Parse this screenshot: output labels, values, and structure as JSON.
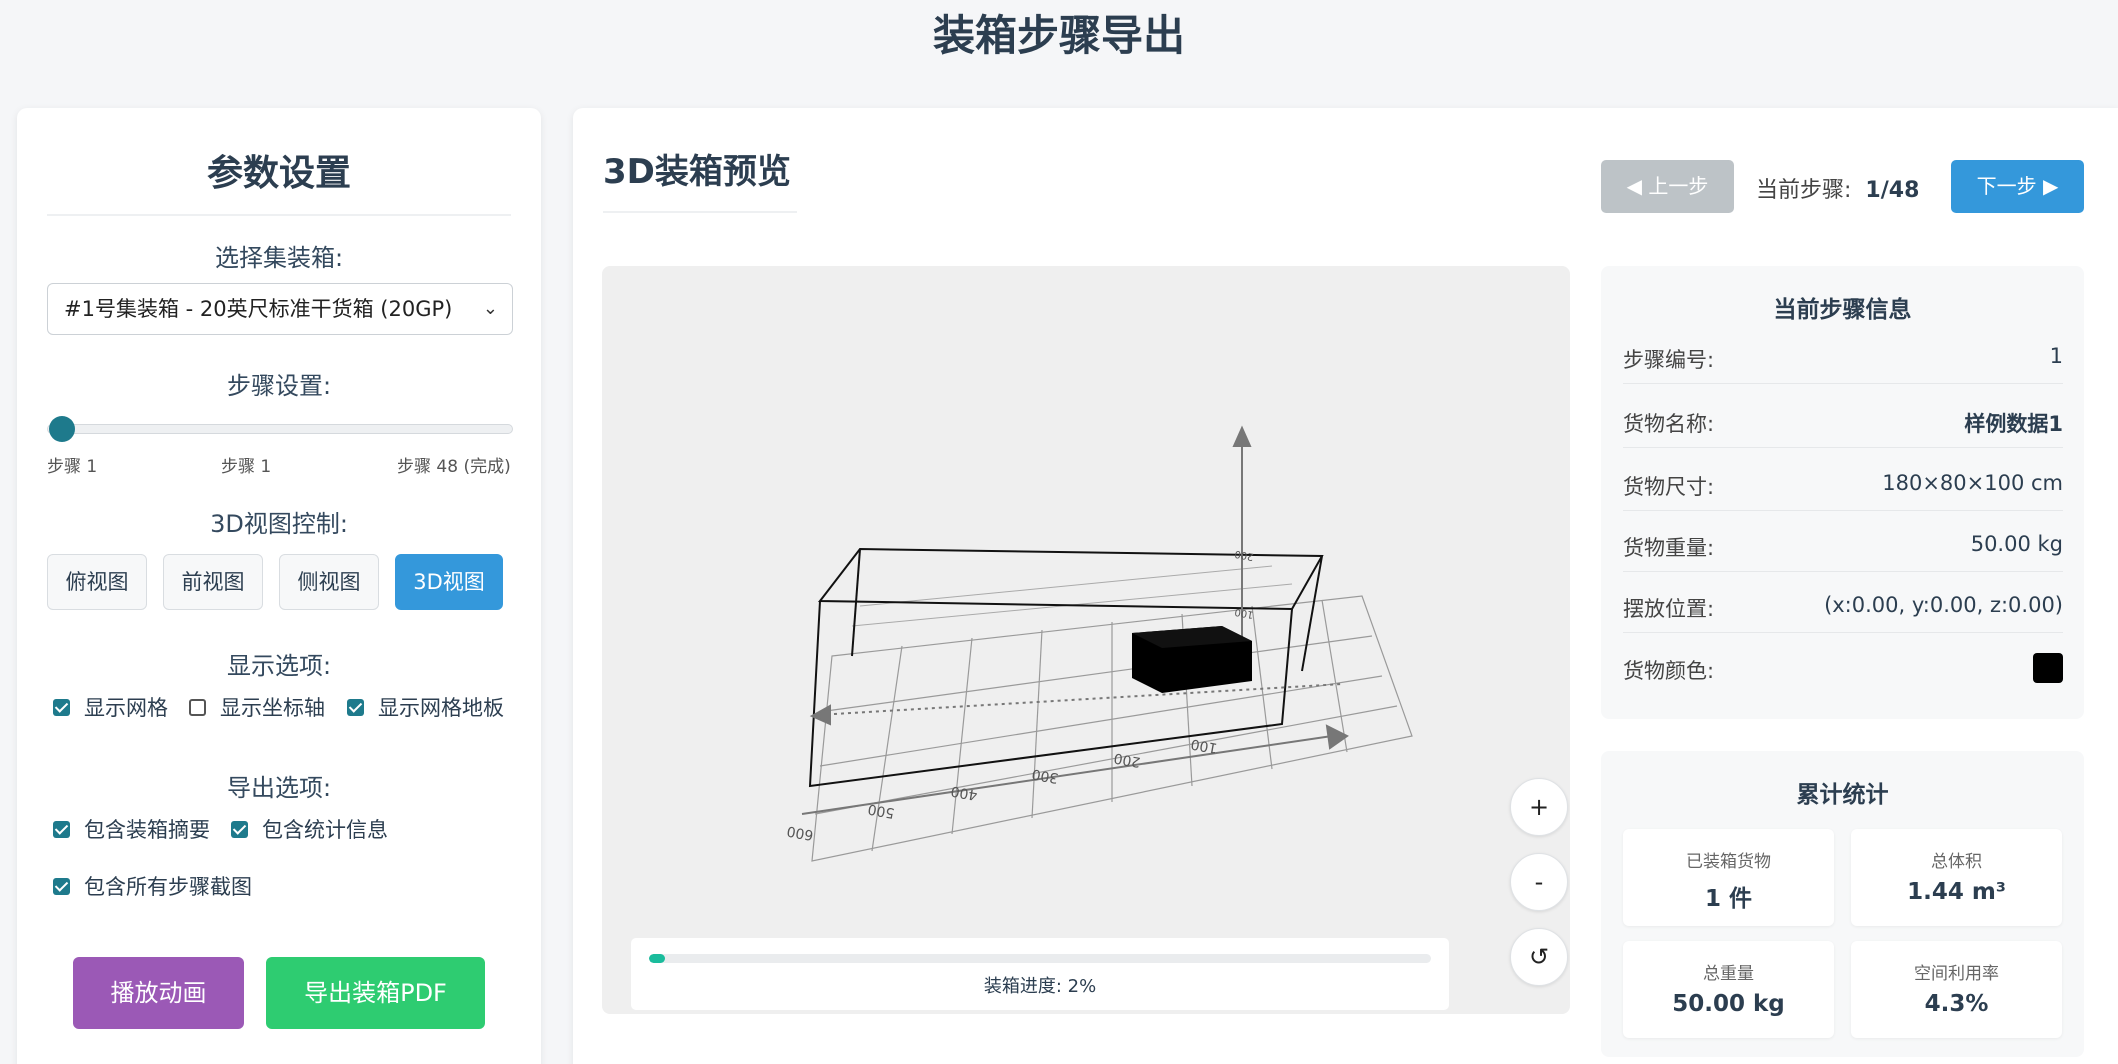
{
  "page": {
    "title": "装箱步骤导出"
  },
  "settings": {
    "title": "参数设置",
    "container_label": "选择集装箱:",
    "container_selected": "#1号集装箱 - 20英尺标准干货箱 (20GP)",
    "step_label": "步骤设置:",
    "step_min": "步骤 1",
    "step_current": "步骤 1",
    "step_max": "步骤 48 (完成)",
    "step_slider_fraction": 0.0,
    "view_label": "3D视图控制:",
    "views": [
      {
        "label": "俯视图",
        "active": false
      },
      {
        "label": "前视图",
        "active": false
      },
      {
        "label": "侧视图",
        "active": false
      },
      {
        "label": "3D视图",
        "active": true
      }
    ],
    "display_label": "显示选项:",
    "display_options": [
      {
        "label": "显示网格",
        "checked": true
      },
      {
        "label": "显示坐标轴",
        "checked": false
      },
      {
        "label": "显示网格地板",
        "checked": true
      }
    ],
    "export_label": "导出选项:",
    "export_options": [
      {
        "label": "包含装箱摘要",
        "checked": true
      },
      {
        "label": "包含统计信息",
        "checked": true
      },
      {
        "label": "包含所有步骤截图",
        "checked": true
      }
    ],
    "play_button": "播放动画",
    "export_button": "导出装箱PDF",
    "colors": {
      "accent": "#1e7a8c",
      "play": "#9b59b6",
      "export": "#2ecc71",
      "active_view": "#3498db"
    }
  },
  "preview": {
    "title": "3D装箱预览",
    "prev_button": "◀ 上一步",
    "next_button": "下一步 ▶",
    "step_text": "当前步骤:",
    "step_value": "1/48",
    "progress_label": "装箱进度: 2%",
    "progress_fraction": 0.02,
    "zoom_in": "+",
    "zoom_out": "-",
    "reset": "↺",
    "scale_labels": [
      "600",
      "500",
      "400",
      "300",
      "200",
      "100"
    ],
    "height_labels": [
      "200",
      "100"
    ],
    "colors": {
      "prev_disabled": "#bdc3c7",
      "next": "#3498db",
      "progress": "#1abc9c"
    }
  },
  "step_info": {
    "title": "当前步骤信息",
    "rows": [
      {
        "key": "步骤编号:",
        "value": "1"
      },
      {
        "key": "货物名称:",
        "value": "样例数据1"
      },
      {
        "key": "货物尺寸:",
        "value": "180×80×100 cm"
      },
      {
        "key": "货物重量:",
        "value": "50.00 kg"
      },
      {
        "key": "摆放位置:",
        "value": "(x:0.00, y:0.00, z:0.00)"
      },
      {
        "key": "货物颜色:",
        "value": "#000000"
      }
    ]
  },
  "stats": {
    "title": "累计统计",
    "items": [
      {
        "label": "已装箱货物",
        "value": "1 件"
      },
      {
        "label": "总体积",
        "value": "1.44 m³"
      },
      {
        "label": "总重量",
        "value": "50.00 kg"
      },
      {
        "label": "空间利用率",
        "value": "4.3%"
      }
    ]
  }
}
